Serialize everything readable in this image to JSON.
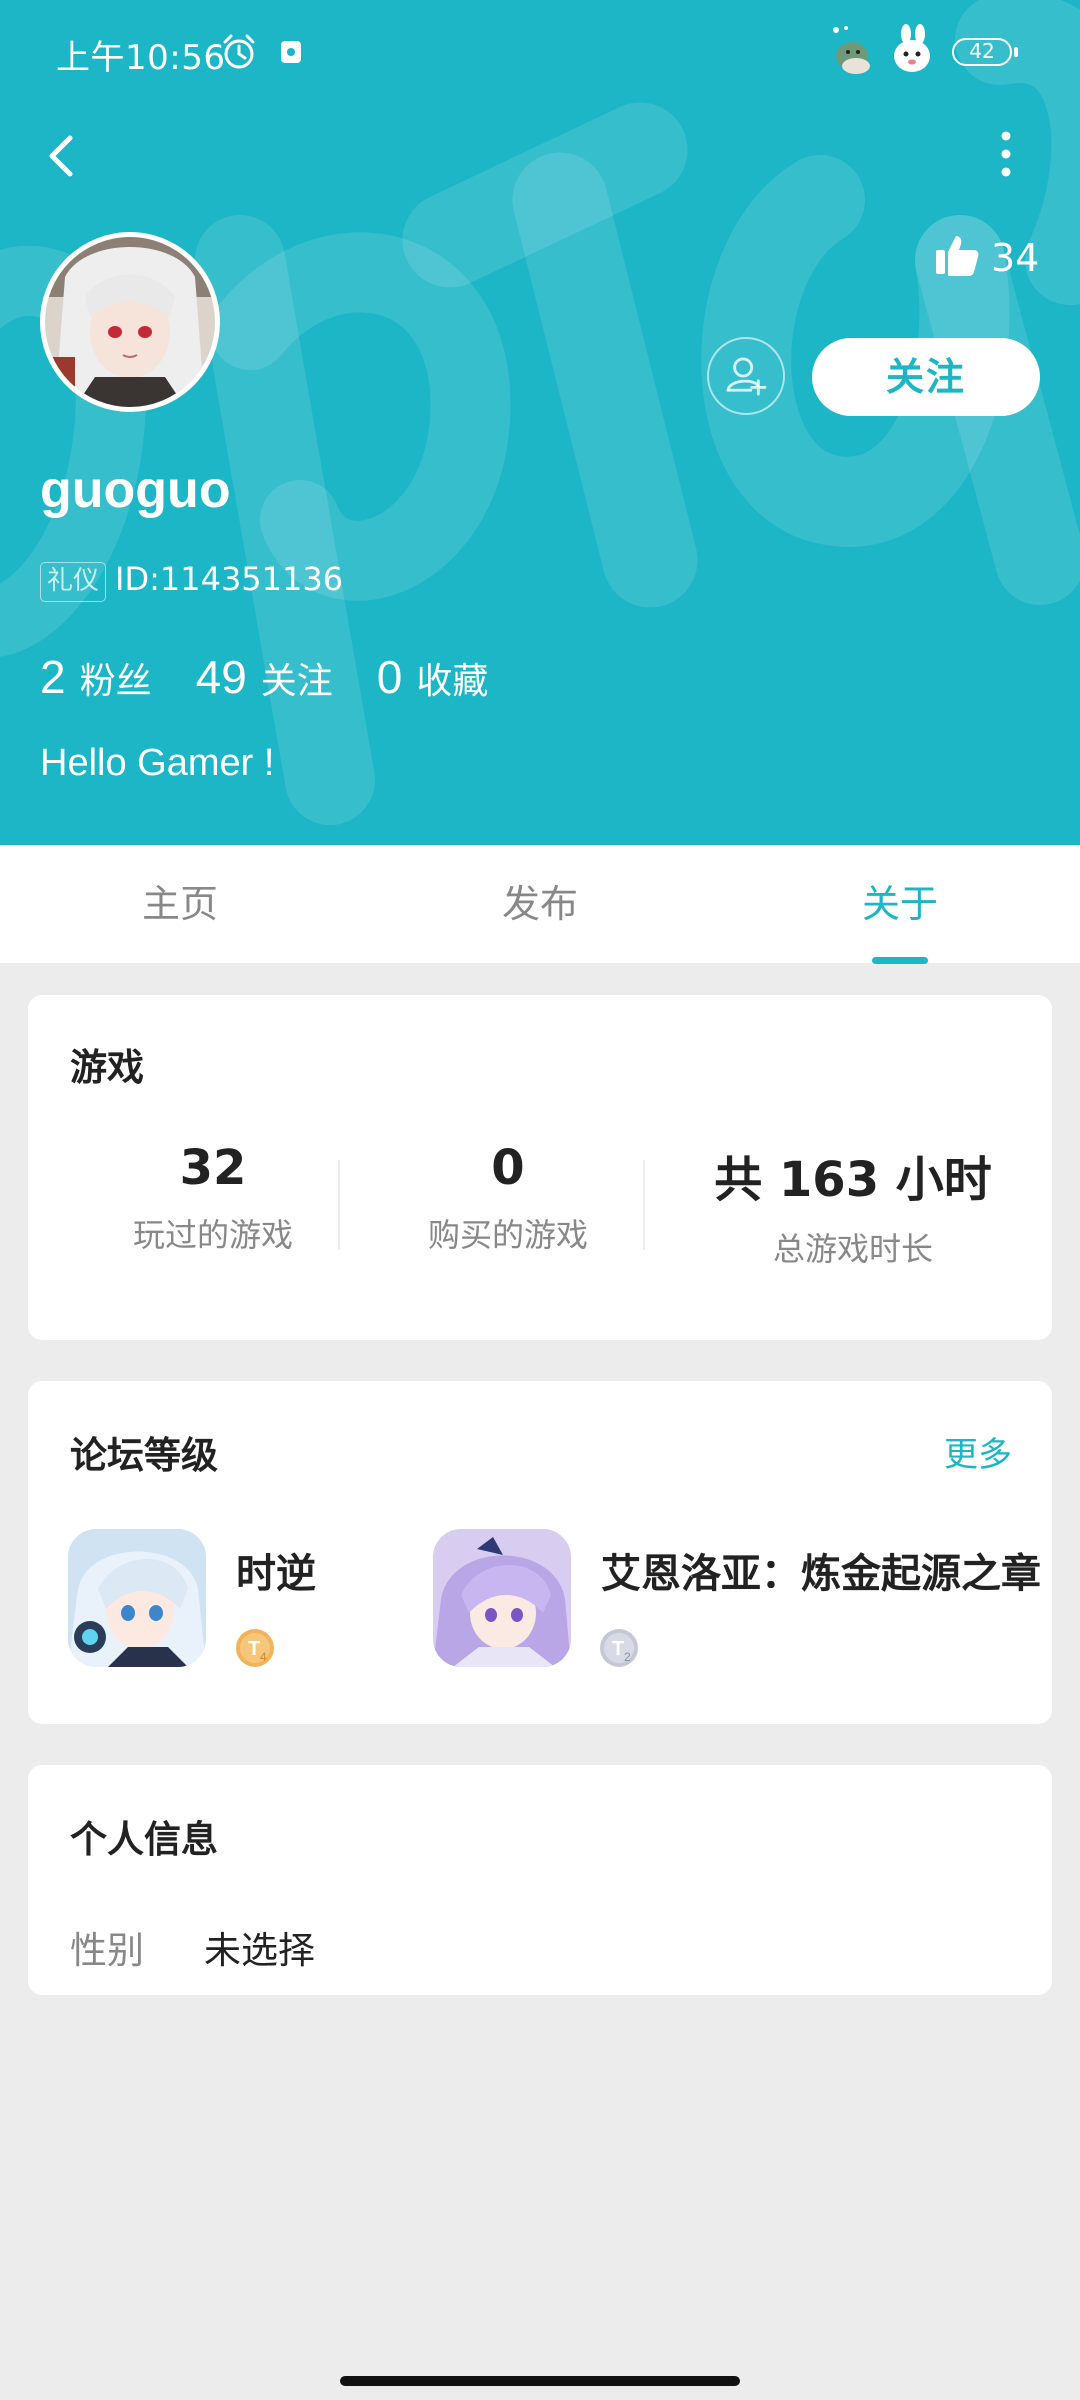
{
  "status_bar": {
    "time": "上午10:56",
    "battery": "42"
  },
  "profile": {
    "likes": "34",
    "follow_label": "关注",
    "username": "guoguo",
    "badge": "礼仪",
    "user_id": "ID:114351136",
    "stats": [
      {
        "num": "2",
        "label": "粉丝"
      },
      {
        "num": "49",
        "label": "关注"
      },
      {
        "num": "0",
        "label": "收藏"
      }
    ],
    "bio": "Hello Gamer !"
  },
  "tabs": [
    {
      "label": "主页"
    },
    {
      "label": "发布"
    },
    {
      "label": "关于",
      "active": true
    }
  ],
  "games_card": {
    "title": "游戏",
    "stats": [
      {
        "num": "32",
        "label": "玩过的游戏"
      },
      {
        "num": "0",
        "label": "购买的游戏"
      },
      {
        "num": "共 163 小时",
        "label": "总游戏时长"
      }
    ]
  },
  "forum_card": {
    "title": "论坛等级",
    "more_label": "更多",
    "games": [
      {
        "name": "时逆",
        "level": "4",
        "badge_color": "#f0b45c"
      },
      {
        "name": "艾恩洛亚：炼金起源之章",
        "level": "2",
        "badge_color": "#c4c8d6"
      }
    ]
  },
  "info_card": {
    "title": "个人信息",
    "gender_label": "性别",
    "gender_value": "未选择"
  },
  "colors": {
    "accent": "#1cb6c7",
    "background": "#ececec"
  }
}
